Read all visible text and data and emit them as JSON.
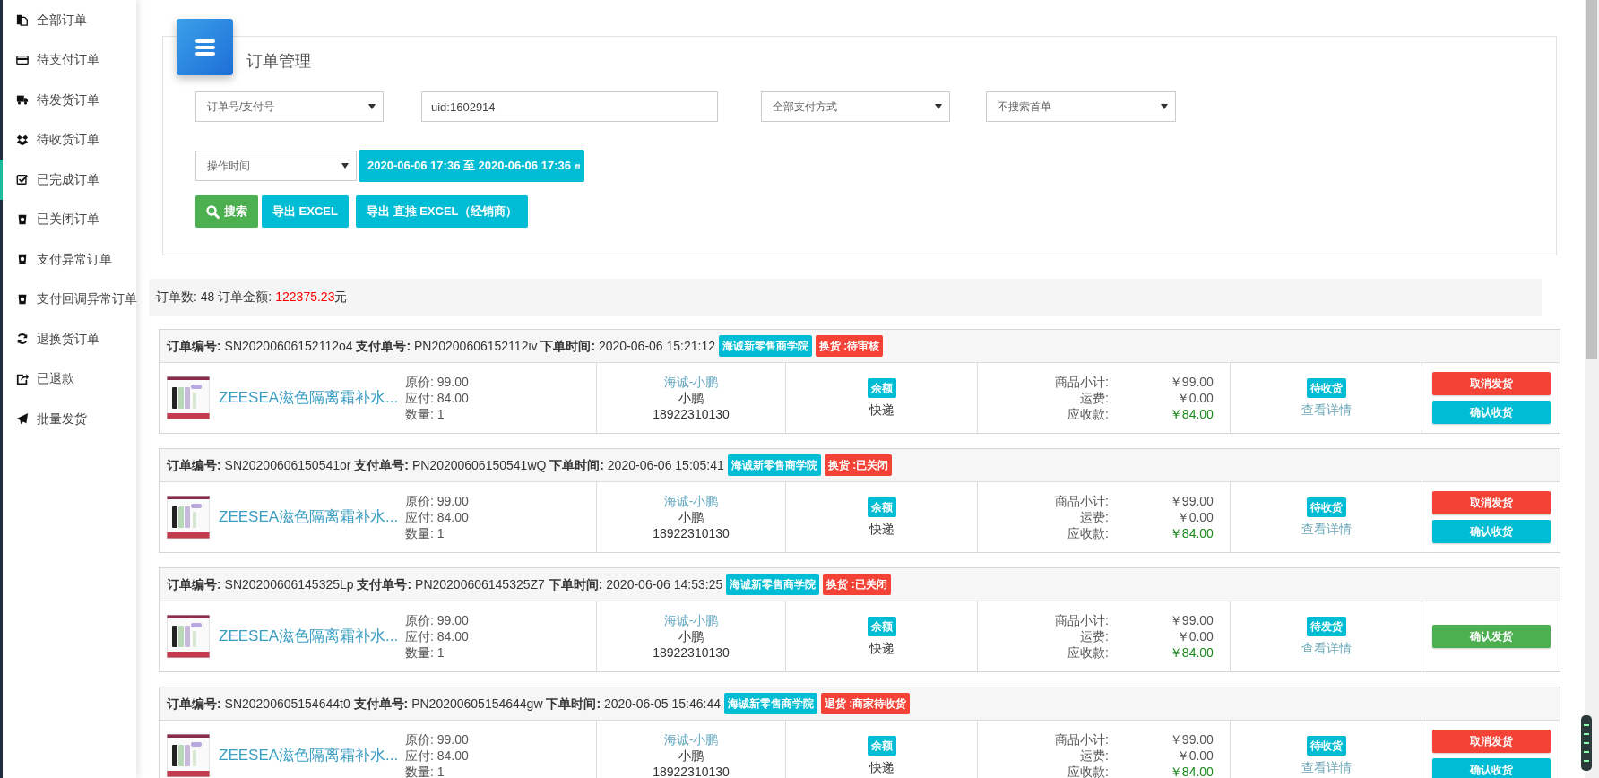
{
  "sidebar": {
    "items": [
      {
        "label": "全部订单",
        "selected": false
      },
      {
        "label": "待支付订单",
        "selected": false
      },
      {
        "label": "待发货订单",
        "selected": false
      },
      {
        "label": "待收货订单",
        "selected": false
      },
      {
        "label": "已完成订单",
        "selected": true
      },
      {
        "label": "已关闭订单",
        "selected": false
      },
      {
        "label": "支付异常订单",
        "selected": false
      },
      {
        "label": "支付回调异常订单",
        "selected": false
      },
      {
        "label": "退换货订单",
        "selected": false
      },
      {
        "label": "已退款",
        "selected": false
      },
      {
        "label": "批量发货",
        "selected": false
      }
    ]
  },
  "filter": {
    "title": "订单管理",
    "search_type": {
      "value": "订单号/支付号"
    },
    "keyword": {
      "value": "uid:1602914"
    },
    "payment_method": {
      "value": "全部支付方式"
    },
    "first_order": {
      "value": "不搜索首单"
    },
    "time_type": {
      "value": "操作时间"
    },
    "date_range": "2020-06-06 17:36 至 2020-06-06 17:36",
    "buttons": [
      {
        "label": "搜索",
        "kind": "search"
      },
      {
        "label": "导出 EXCEL",
        "kind": "info"
      },
      {
        "label": "导出 直推 EXCEL（经销商）",
        "kind": "info"
      }
    ]
  },
  "summary": {
    "count_text": "订单数: 48",
    "amount_label": "订单金额:",
    "amount": "122375.23",
    "unit": "元"
  },
  "orders": [
    {
      "header": "**订单编号:** SN20200606152112o4 **支付单号:** PN20200606152112iv **下单时间:** 2020-06-06 15:21:12",
      "tags": [
        {
          "text": "海诚新零售商学院",
          "color": "#00bcd4"
        },
        {
          "text": "换货 :待审核",
          "color": "#f44336"
        }
      ],
      "product": {
        "name": "ZEESEA滋色隔离霜补水...",
        "lines": [
          "原价: 99.00",
          "应付: 84.00",
          "数量: 1"
        ]
      },
      "buyer": {
        "nickname": "海诚-小鹏",
        "name": "小鹏",
        "phone": "18922310130"
      },
      "payment": {
        "method": "余额",
        "shipping": "快递"
      },
      "amounts": [
        {
          "label": "商品小计:",
          "value": "￥99.00",
          "emphasis": false
        },
        {
          "label": "运费:",
          "value": "￥0.00",
          "emphasis": false
        },
        {
          "label": "应收款:",
          "value": "￥84.00",
          "emphasis": true
        }
      ],
      "status": "待收货",
      "detail_link": "查看详情",
      "actions": [
        {
          "label": "取消发货",
          "kind": "danger"
        },
        {
          "label": "确认收货",
          "kind": "info"
        }
      ]
    },
    {
      "header": "**订单编号:** SN20200606150541or **支付单号:** PN20200606150541wQ **下单时间:** 2020-06-06 15:05:41",
      "tags": [
        {
          "text": "海诚新零售商学院",
          "color": "#00bcd4"
        },
        {
          "text": "换货 :已关闭",
          "color": "#f44336"
        }
      ],
      "product": {
        "name": "ZEESEA滋色隔离霜补水...",
        "lines": [
          "原价: 99.00",
          "应付: 84.00",
          "数量: 1"
        ]
      },
      "buyer": {
        "nickname": "海诚-小鹏",
        "name": "小鹏",
        "phone": "18922310130"
      },
      "payment": {
        "method": "余额",
        "shipping": "快递"
      },
      "amounts": [
        {
          "label": "商品小计:",
          "value": "￥99.00",
          "emphasis": false
        },
        {
          "label": "运费:",
          "value": "￥0.00",
          "emphasis": false
        },
        {
          "label": "应收款:",
          "value": "￥84.00",
          "emphasis": true
        }
      ],
      "status": "待收货",
      "detail_link": "查看详情",
      "actions": [
        {
          "label": "取消发货",
          "kind": "danger"
        },
        {
          "label": "确认收货",
          "kind": "info"
        }
      ]
    },
    {
      "header": "**订单编号:** SN20200606145325Lp **支付单号:** PN20200606145325Z7 **下单时间:** 2020-06-06 14:53:25",
      "tags": [
        {
          "text": "海诚新零售商学院",
          "color": "#00bcd4"
        },
        {
          "text": "换货 :已关闭",
          "color": "#f44336"
        }
      ],
      "product": {
        "name": "ZEESEA滋色隔离霜补水...",
        "lines": [
          "原价: 99.00",
          "应付: 84.00",
          "数量: 1"
        ]
      },
      "buyer": {
        "nickname": "海诚-小鹏",
        "name": "小鹏",
        "phone": "18922310130"
      },
      "payment": {
        "method": "余额",
        "shipping": "快递"
      },
      "amounts": [
        {
          "label": "商品小计:",
          "value": "￥99.00",
          "emphasis": false
        },
        {
          "label": "运费:",
          "value": "￥0.00",
          "emphasis": false
        },
        {
          "label": "应收款:",
          "value": "￥84.00",
          "emphasis": true
        }
      ],
      "status": "待发货",
      "detail_link": "查看详情",
      "actions": [
        {
          "label": "确认发货",
          "kind": "success"
        }
      ]
    },
    {
      "header": "**订单编号:** SN20200605154644t0 **支付单号:** PN20200605154644gw **下单时间:** 2020-06-05 15:46:44",
      "tags": [
        {
          "text": "海诚新零售商学院",
          "color": "#00bcd4"
        },
        {
          "text": "退货 :商家待收货",
          "color": "#f44336"
        }
      ],
      "product": {
        "name": "ZEESEA滋色隔离霜补水...",
        "lines": [
          "原价: 99.00",
          "应付: 84.00",
          "数量: 1"
        ]
      },
      "buyer": {
        "nickname": "海诚-小鹏",
        "name": "小鹏",
        "phone": "18922310130"
      },
      "payment": {
        "method": "余额",
        "shipping": "快递"
      },
      "amounts": [
        {
          "label": "商品小计:",
          "value": "￥99.00",
          "emphasis": false
        },
        {
          "label": "运费:",
          "value": "￥0.00",
          "emphasis": false
        },
        {
          "label": "应收款:",
          "value": "￥84.00",
          "emphasis": true
        }
      ],
      "status": "待收货",
      "detail_link": "查看详情",
      "actions": [
        {
          "label": "取消发货",
          "kind": "danger"
        },
        {
          "label": "确认收货",
          "kind": "info"
        }
      ]
    }
  ]
}
